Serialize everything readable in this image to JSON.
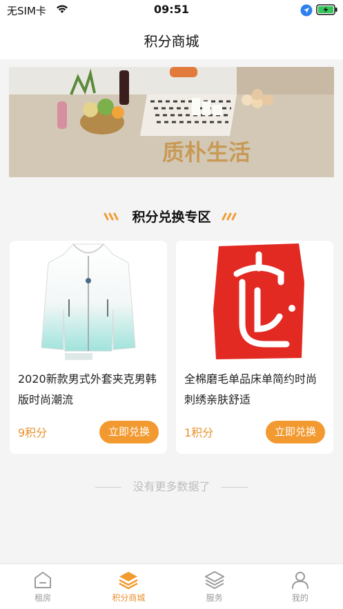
{
  "status_bar": {
    "carrier": "无SIM卡",
    "time": "09:51"
  },
  "header": {
    "title": "积分商城"
  },
  "banner": {
    "text": "质朴生活"
  },
  "section": {
    "title": "积分兑换专区"
  },
  "products": [
    {
      "title": "2020新款男式外套夹克男韩版时尚潮流",
      "points": "9积分",
      "button": "立即兑换",
      "image_icon": "jacket-image"
    },
    {
      "title": "全棉磨毛单品床单简约时尚刺绣亲肤舒适",
      "points": "1积分",
      "button": "立即兑换",
      "image_icon": "seal-image"
    }
  ],
  "footer_note": "没有更多数据了",
  "tabs": [
    {
      "label": "租房",
      "icon": "home-icon",
      "active": false
    },
    {
      "label": "积分商城",
      "icon": "layers-icon",
      "active": true
    },
    {
      "label": "服务",
      "icon": "layers-outline-icon",
      "active": false
    },
    {
      "label": "我的",
      "icon": "user-icon",
      "active": false
    }
  ],
  "colors": {
    "accent": "#f29a30",
    "points": "#e9902d",
    "seal_red": "#e22a22"
  }
}
